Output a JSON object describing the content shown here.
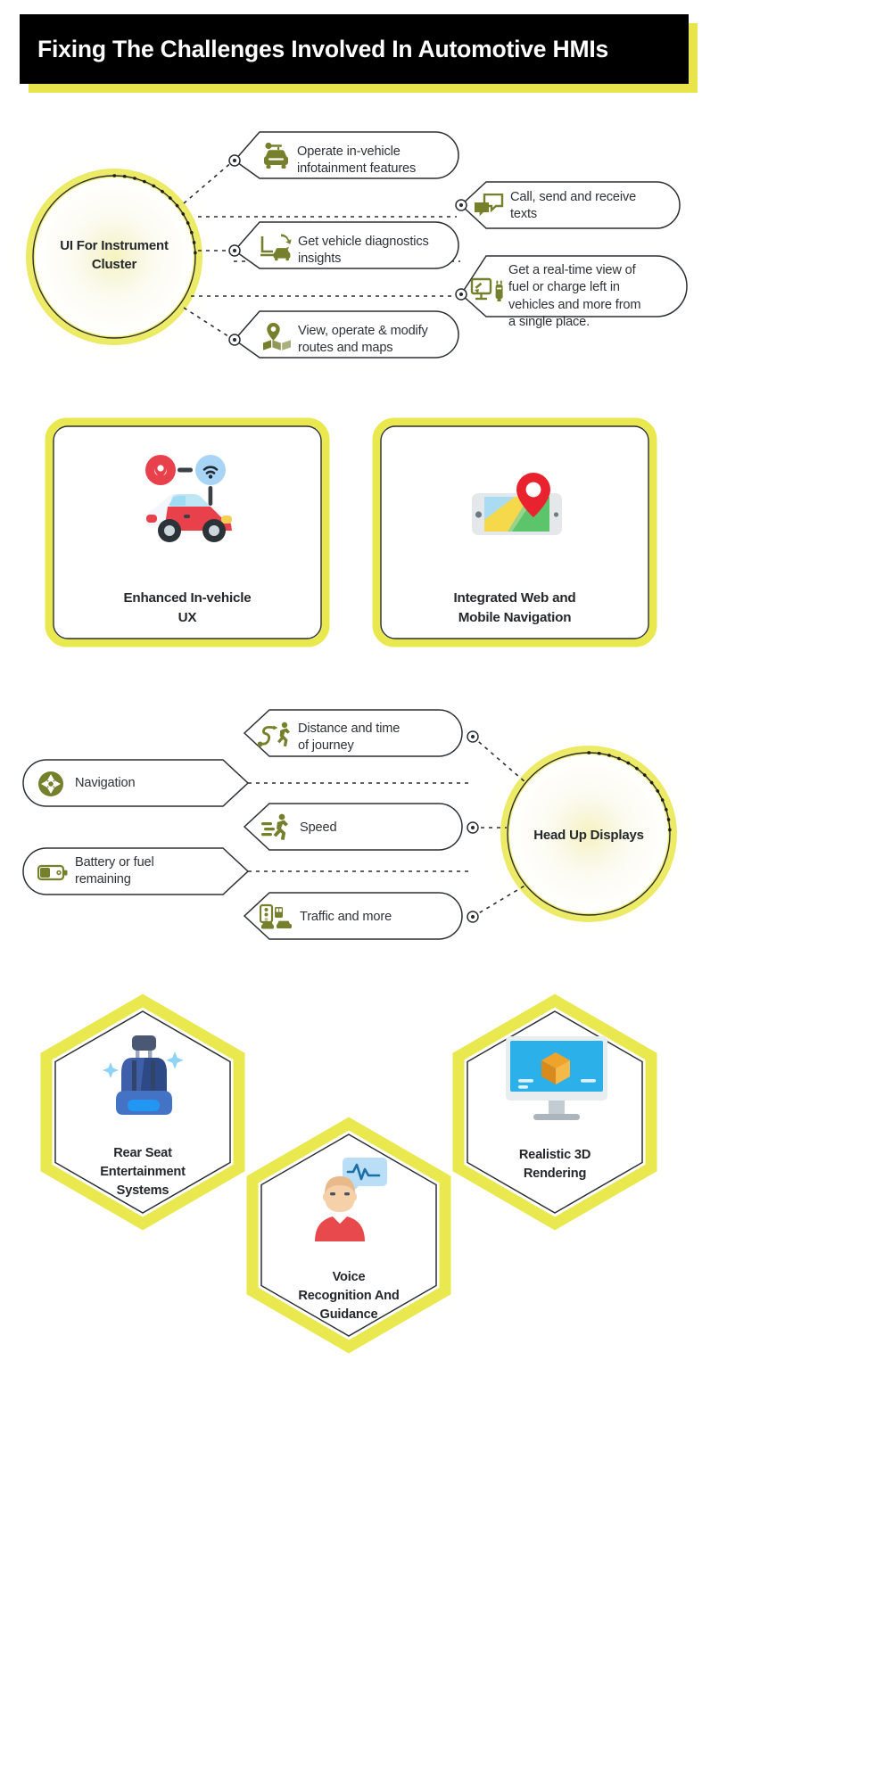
{
  "header": {
    "title": "Fixing The Challenges Involved In Automotive HMIs"
  },
  "colors": {
    "yellow": "#e8e44a",
    "yellow_bright": "#eae84f",
    "black": "#000000",
    "olive": "#76802c",
    "dark_text": "#25282b",
    "body_text": "#2e3236",
    "line": "#2b2f33",
    "red": "#e8414c",
    "blue": "#4aa3e8",
    "seat_blue": "#3f5fa8"
  },
  "section_instrument_cluster": {
    "hub_label_line1": "UI For Instrument",
    "hub_label_line2": "Cluster",
    "left_callouts": [
      {
        "icon": "car-key-icon",
        "line1": "Operate in-vehicle",
        "line2": "infotainment features"
      },
      {
        "icon": "vehicle-diagnostics-icon",
        "line1": "Get vehicle diagnostics",
        "line2": "insights"
      },
      {
        "icon": "map-route-icon",
        "line1": "View, operate & modify",
        "line2": "routes and maps"
      }
    ],
    "right_callouts": [
      {
        "icon": "chat-bubbles-icon",
        "lines": [
          "Call, send and receive",
          "texts"
        ]
      },
      {
        "icon": "fuel-charge-icon",
        "lines": [
          "Get a real-time view of",
          "fuel or charge left in",
          "vehicles and more from",
          "a single place."
        ]
      }
    ]
  },
  "section_cards": [
    {
      "icon": "connected-car-icon",
      "title_line1": "Enhanced In-vehicle",
      "title_line2": "UX"
    },
    {
      "icon": "mobile-map-icon",
      "title_line1": "Integrated Web and",
      "title_line2": "Mobile Navigation"
    }
  ],
  "section_hud": {
    "hub_label": "Head Up Displays",
    "left_items": [
      {
        "icon": "compass-icon",
        "lines": [
          "Navigation"
        ]
      },
      {
        "icon": "battery-icon",
        "lines": [
          "Battery or fuel",
          "remaining"
        ]
      }
    ],
    "right_items": [
      {
        "icon": "distance-time-icon",
        "lines": [
          "Distance and time",
          "of journey"
        ]
      },
      {
        "icon": "running-speed-icon",
        "lines": [
          "Speed"
        ]
      },
      {
        "icon": "traffic-icon",
        "lines": [
          "Traffic and more"
        ]
      }
    ]
  },
  "section_hexagons": [
    {
      "icon": "car-seat-icon",
      "lines": [
        "Rear Seat",
        "Entertainment",
        "Systems"
      ]
    },
    {
      "icon": "voice-recognition-icon",
      "lines": [
        "Voice",
        "Recognition And",
        "Guidance"
      ]
    },
    {
      "icon": "monitor-3d-icon",
      "lines": [
        "Realistic 3D",
        "Rendering"
      ]
    }
  ]
}
